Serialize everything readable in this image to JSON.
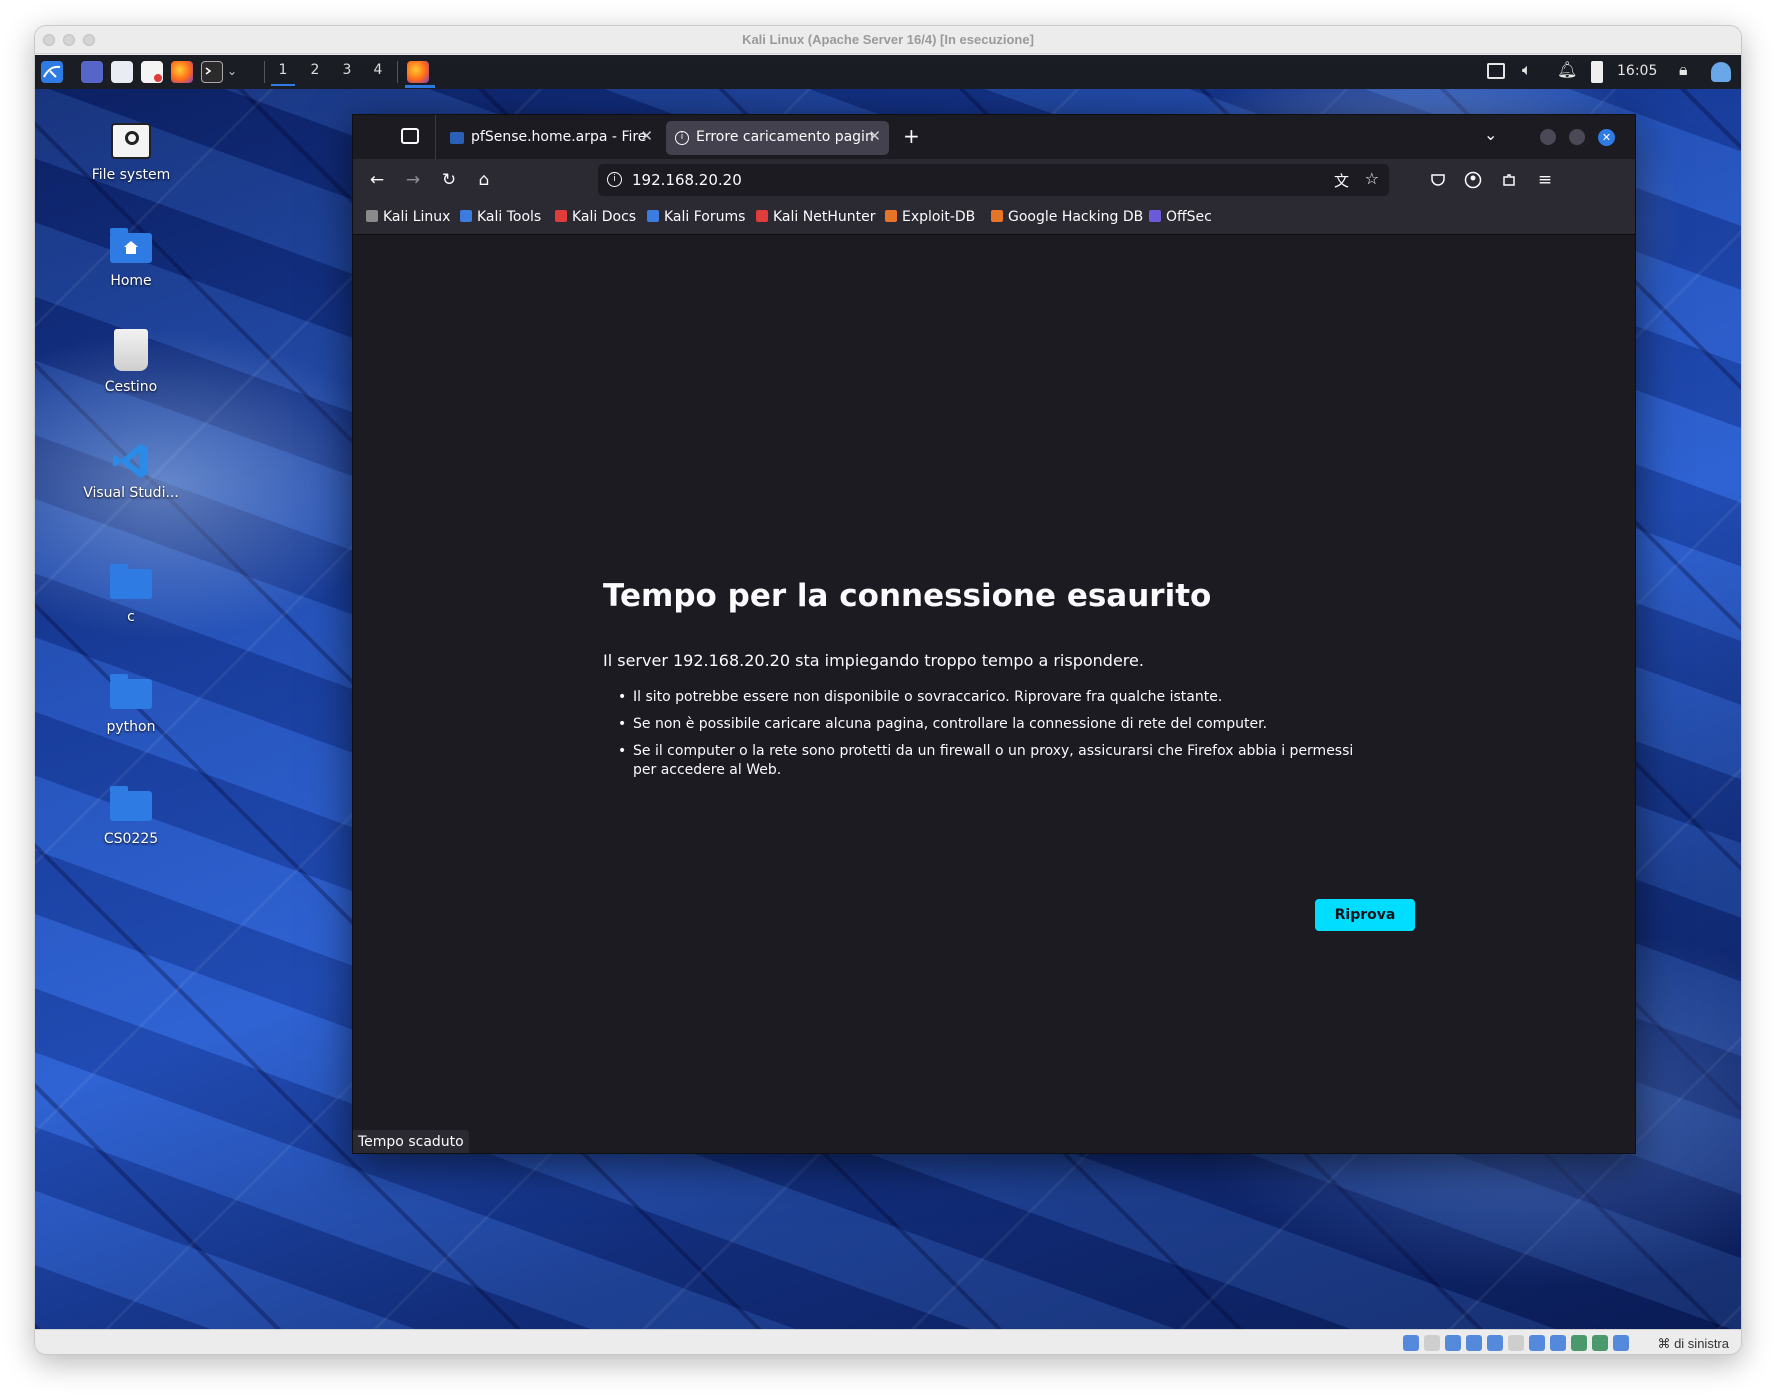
{
  "vm": {
    "title": "Kali Linux (Apache Server 16/4) [In esecuzione]",
    "host_key_label": "⌘ di sinistra"
  },
  "panel": {
    "workspaces": [
      "1",
      "2",
      "3",
      "4"
    ],
    "active_workspace": "1",
    "clock": "16:05"
  },
  "desktop": {
    "icons": [
      {
        "label": "File system",
        "icon": "drive-icon"
      },
      {
        "label": "Home",
        "icon": "home-folder-icon"
      },
      {
        "label": "Cestino",
        "icon": "trash-icon"
      },
      {
        "label": "Visual Studi...",
        "icon": "vscode-icon"
      },
      {
        "label": "c",
        "icon": "folder-icon"
      },
      {
        "label": "python",
        "icon": "folder-icon"
      },
      {
        "label": "CS0225",
        "icon": "folder-icon"
      }
    ]
  },
  "browser": {
    "tabs": [
      {
        "label": "pfSense.home.arpa - Fire"
      },
      {
        "label": "Errore caricamento pagin"
      }
    ],
    "url": "192.168.20.20",
    "bookmarks": [
      {
        "label": "Kali Linux",
        "color": "#8a8a8a"
      },
      {
        "label": "Kali Tools",
        "color": "#3c7be0"
      },
      {
        "label": "Kali Docs",
        "color": "#e03c3c"
      },
      {
        "label": "Kali Forums",
        "color": "#3c7be0"
      },
      {
        "label": "Kali NetHunter",
        "color": "#e03c3c"
      },
      {
        "label": "Exploit-DB",
        "color": "#e8742a"
      },
      {
        "label": "Google Hacking DB",
        "color": "#e8742a"
      },
      {
        "label": "OffSec",
        "color": "#6a5cd8"
      }
    ],
    "error": {
      "title": "Tempo per la connessione esaurito",
      "description": "Il server 192.168.20.20 sta impiegando troppo tempo a rispondere.",
      "bullets": [
        "Il sito potrebbe essere non disponibile o sovraccarico. Riprovare fra qualche istante.",
        "Se non è possibile caricare alcuna pagina, controllare la connessione di rete del computer.",
        "Se il computer o la rete sono protetti da un firewall o un proxy, assicurarsi che Firefox abbia i permessi per accedere al Web."
      ],
      "retry_label": "Riprova"
    },
    "status_text": "Tempo scaduto",
    "accent_color": "#00ddff"
  }
}
